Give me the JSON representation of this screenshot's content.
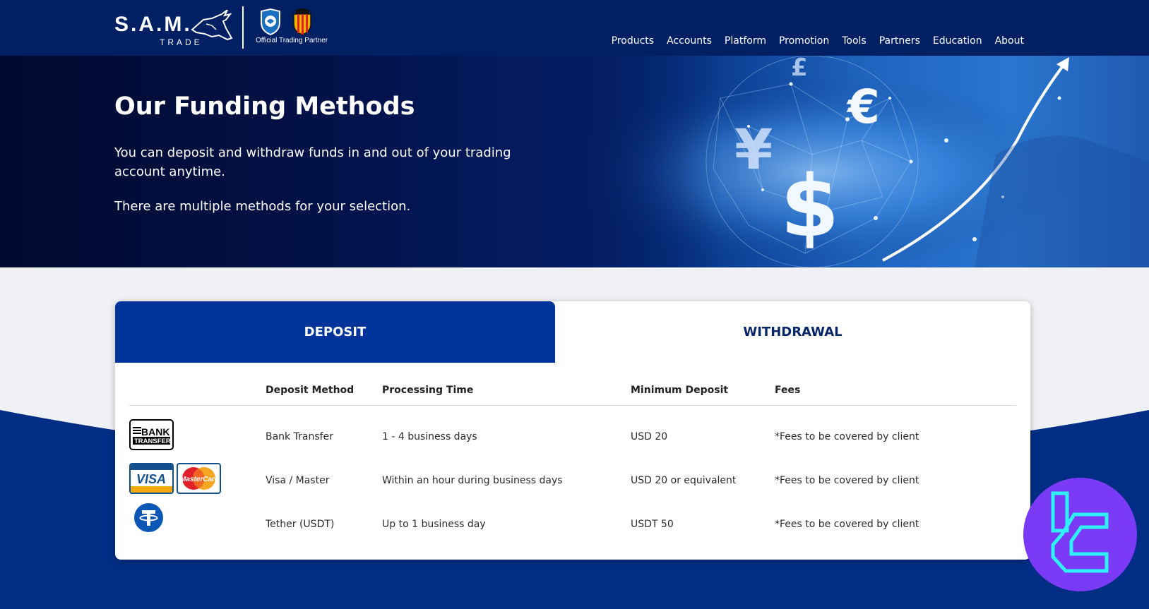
{
  "header": {
    "logo_text": "S.A.M.",
    "logo_sub": "TRADE",
    "partner_label": "Official Trading Partner",
    "nav": [
      {
        "label": "Products"
      },
      {
        "label": "Accounts"
      },
      {
        "label": "Platform"
      },
      {
        "label": "Promotion"
      },
      {
        "label": "Tools"
      },
      {
        "label": "Partners"
      },
      {
        "label": "Education"
      },
      {
        "label": "About"
      }
    ]
  },
  "hero": {
    "title": "Our Funding Methods",
    "paragraph1": "You can deposit and withdraw funds in and out of your trading account anytime.",
    "paragraph2": "There are multiple methods for your selection.",
    "art_symbols": [
      "£",
      "€",
      "¥",
      "$"
    ]
  },
  "tabs": {
    "active": "deposit",
    "deposit": "DEPOSIT",
    "withdrawal": "WITHDRAWAL"
  },
  "table": {
    "headers": {
      "method": "Deposit Method",
      "time": "Processing Time",
      "minimum": "Minimum Deposit",
      "fees": "Fees"
    },
    "rows": [
      {
        "icons": [
          "bank-transfer-icon"
        ],
        "method": "Bank Transfer",
        "time": "1 - 4 business days",
        "minimum": "USD 20",
        "fees": "*Fees to be covered by client"
      },
      {
        "icons": [
          "visa-icon",
          "mastercard-icon"
        ],
        "method": "Visa / Master",
        "time": "Within an hour during business days",
        "minimum": "USD 20 or equivalent",
        "fees": "*Fees to be covered by client"
      },
      {
        "icons": [
          "tether-icon"
        ],
        "method": "Tether (USDT)",
        "time": "Up to 1 business day",
        "minimum": "USDT 50",
        "fees": "*Fees to be covered by client"
      }
    ],
    "icon_labels": {
      "bank_line1": "BANK",
      "bank_line2": "TRANSFER",
      "visa": "VISA",
      "mastercard": "MasterCard",
      "tether": "T"
    }
  },
  "colors": {
    "header_bg": "#012064",
    "brand_blue": "#00349a",
    "withdraw_text": "#06266b",
    "page_bg": "#f0f1f4",
    "watermark_purple": "#7b3af5",
    "watermark_cyan": "#2ef2f7"
  }
}
